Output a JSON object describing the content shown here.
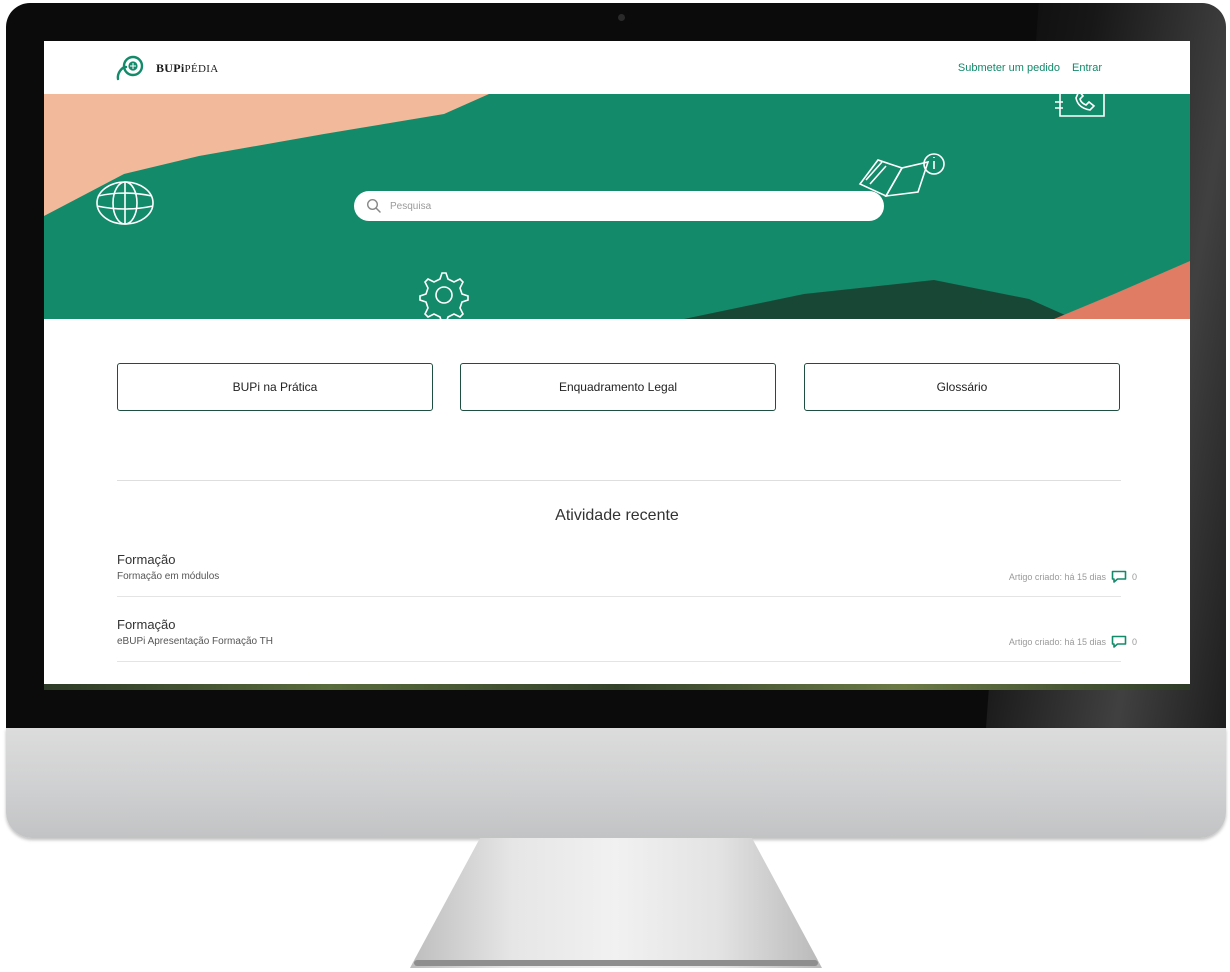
{
  "site": {
    "logo_bold": "BUPi",
    "logo_rest": "PÉDIA",
    "nav": [
      {
        "label": "Submeter um pedido"
      },
      {
        "label": "Entrar"
      }
    ]
  },
  "colors": {
    "brand_green": "#138a6a",
    "peach": "#f2b99a",
    "coral": "#e07b64",
    "dark_green": "#184736"
  },
  "search": {
    "placeholder": "Pesquisa"
  },
  "categories": [
    {
      "label": "BUPi na Prática"
    },
    {
      "label": "Enquadramento Legal"
    },
    {
      "label": "Glossário"
    }
  ],
  "recent": {
    "title": "Atividade recente",
    "items": [
      {
        "title": "Formação",
        "subtitle": "Formação em módulos",
        "meta": "Artigo criado: há 15 dias",
        "comments": "0"
      },
      {
        "title": "Formação",
        "subtitle": "eBUPi Apresentação Formação TH",
        "meta": "Artigo criado: há 15 dias",
        "comments": "0"
      }
    ]
  },
  "icons": [
    "globe-icon",
    "gear-icon",
    "book-info-icon",
    "phone-book-icon",
    "search-icon",
    "comment-icon"
  ]
}
